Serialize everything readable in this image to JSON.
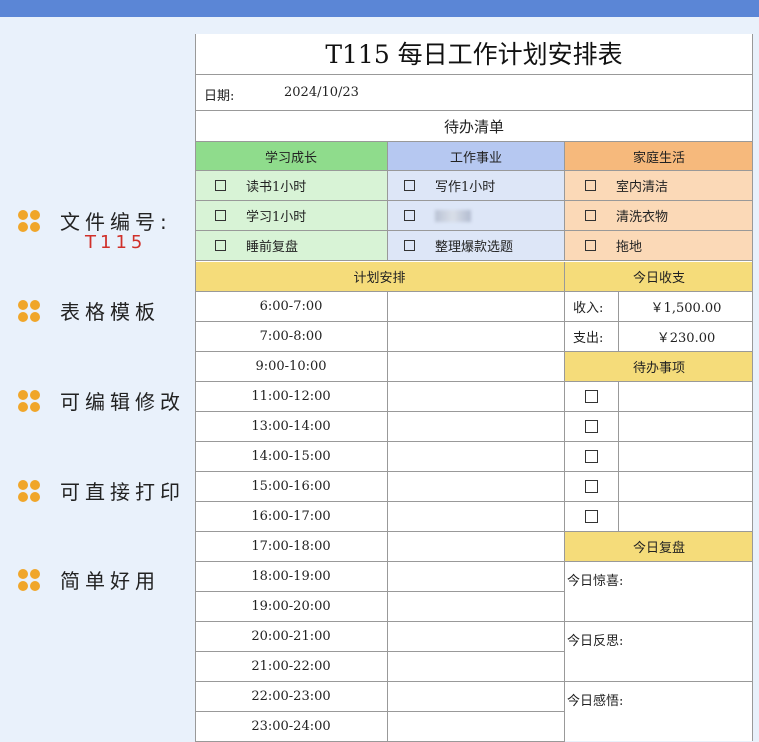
{
  "features": [
    {
      "label": "文件编号:",
      "code": "T115"
    },
    {
      "label": "表格模板"
    },
    {
      "label": "可编辑修改"
    },
    {
      "label": "可直接打印"
    },
    {
      "label": "简单好用"
    }
  ],
  "sheet": {
    "title": "T115 每日工作计划安排表",
    "date_label": "日期:",
    "date_value": "2024/10/23",
    "todo_section_title": "待办清单",
    "categories": [
      {
        "name": "学习成长",
        "header_color": "#8fdc8c",
        "cell_color": "#d8f3d6",
        "items": [
          "读书1小时",
          "学习1小时",
          "睡前复盘"
        ]
      },
      {
        "name": "工作事业",
        "header_color": "#b6c8f1",
        "cell_color": "#dde6f7",
        "items": [
          "写作1小时",
          "",
          "整理爆款选题"
        ]
      },
      {
        "name": "家庭生活",
        "header_color": "#f6b97c",
        "cell_color": "#fbd9b7",
        "items": [
          "室内清洁",
          "清洗衣物",
          "拖地"
        ]
      }
    ],
    "plan_title": "计划安排",
    "time_slots": [
      "6:00-7:00",
      "7:00-8:00",
      "9:00-10:00",
      "11:00-12:00",
      "13:00-14:00",
      "14:00-15:00",
      "15:00-16:00",
      "16:00-17:00",
      "17:00-18:00",
      "18:00-19:00",
      "19:00-20:00",
      "20:00-21:00",
      "21:00-22:00",
      "22:00-23:00",
      "23:00-24:00"
    ],
    "finance": {
      "title": "今日收支",
      "income_label": "收入:",
      "income_value": "￥1,500.00",
      "expense_label": "支出:",
      "expense_value": "￥230.00"
    },
    "todo_items_title": "待办事项",
    "review": {
      "title": "今日复盘",
      "surprise_label": "今日惊喜:",
      "reflection_label": "今日反思:",
      "insight_label": "今日感悟:"
    },
    "section_yellow": "#f5dc7a"
  }
}
